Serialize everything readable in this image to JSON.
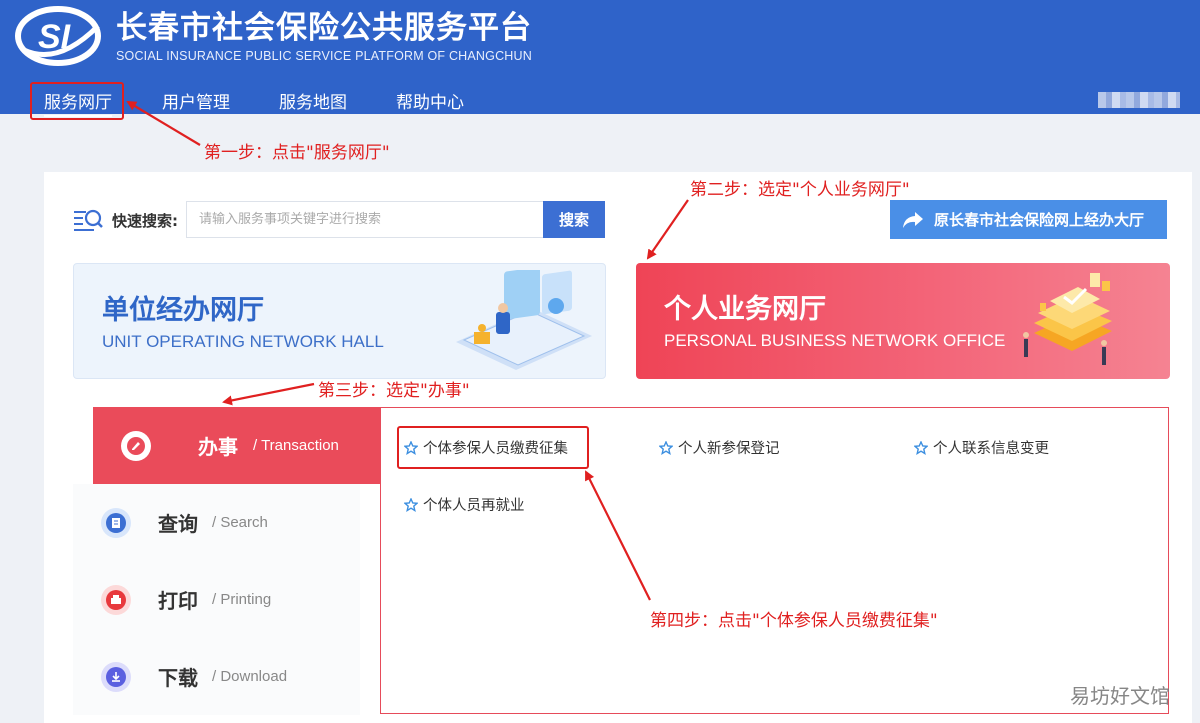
{
  "header": {
    "logo_text": "SI",
    "title": "长春市社会保险公共服务平台",
    "subtitle": "SOCIAL INSURANCE PUBLIC SERVICE PLATFORM OF CHANGCHUN"
  },
  "nav": {
    "items": [
      {
        "label": "服务网厅",
        "active": true
      },
      {
        "label": "用户管理",
        "active": false
      },
      {
        "label": "服务地图",
        "active": false
      },
      {
        "label": "帮助中心",
        "active": false
      }
    ]
  },
  "annotations": {
    "step1": "第一步：点击\"服务网厅\"",
    "step2": "第二步：选定\"个人业务网厅\"",
    "step3": "第三步：选定\"办事\"",
    "step4": "第四步：点击\"个体参保人员缴费征集\"",
    "color": "#e02020"
  },
  "search": {
    "label": "快速搜索:",
    "placeholder": "请输入服务事项关键字进行搜索",
    "value": "",
    "button_label": "搜索"
  },
  "old_hall_button": {
    "label": "原长春市社会保险网上经办大厅",
    "icon": "share-arrow-icon"
  },
  "cards": {
    "unit": {
      "title": "单位经办网厅",
      "subtitle": "UNIT OPERATING NETWORK HALL"
    },
    "personal": {
      "title": "个人业务网厅",
      "subtitle": "PERSONAL BUSINESS NETWORK OFFICE"
    }
  },
  "tabs": [
    {
      "label": "办事",
      "sub": "/ Transaction",
      "icon": "pen-icon",
      "active": true
    },
    {
      "label": "查询",
      "sub": "/ Search",
      "icon": "document-icon",
      "active": false
    },
    {
      "label": "打印",
      "sub": "/ Printing",
      "icon": "printer-icon",
      "active": false
    },
    {
      "label": "下载",
      "sub": "/ Download",
      "icon": "download-icon",
      "active": false
    }
  ],
  "services": [
    "个体参保人员缴费征集",
    "个人新参保登记",
    "个人联系信息变更",
    "个体人员再就业"
  ],
  "watermark": "易坊好文馆",
  "colors": {
    "header_bg": "#2f63c9",
    "accent_red": "#ea4b5a",
    "accent_blue": "#3c6fd3"
  }
}
